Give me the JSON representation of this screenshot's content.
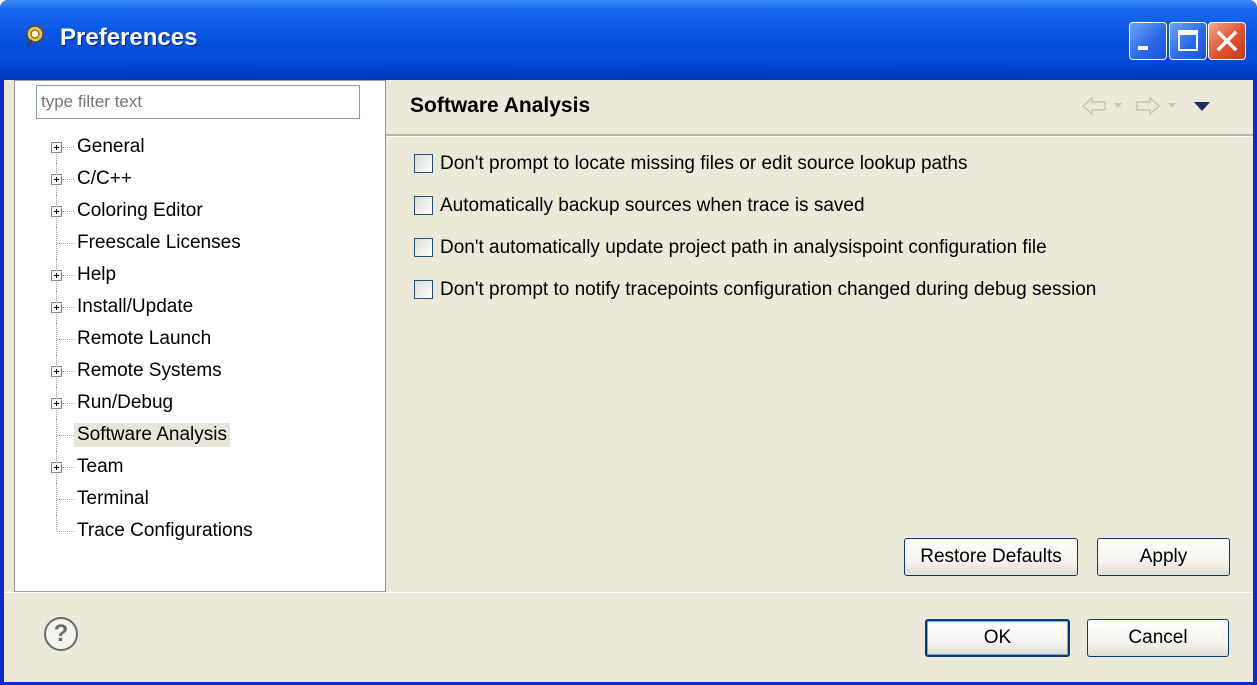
{
  "window": {
    "title": "Preferences"
  },
  "filter": {
    "placeholder": "type filter text",
    "value": ""
  },
  "tree": {
    "items": [
      {
        "label": "General",
        "expandable": true
      },
      {
        "label": "C/C++",
        "expandable": true
      },
      {
        "label": "Coloring Editor",
        "expandable": true
      },
      {
        "label": "Freescale Licenses",
        "expandable": false
      },
      {
        "label": "Help",
        "expandable": true
      },
      {
        "label": "Install/Update",
        "expandable": true
      },
      {
        "label": "Remote Launch",
        "expandable": false
      },
      {
        "label": "Remote Systems",
        "expandable": true
      },
      {
        "label": "Run/Debug",
        "expandable": true
      },
      {
        "label": "Software Analysis",
        "expandable": false,
        "selected": true
      },
      {
        "label": "Team",
        "expandable": true
      },
      {
        "label": "Terminal",
        "expandable": false
      },
      {
        "label": "Trace Configurations",
        "expandable": false
      }
    ]
  },
  "page": {
    "title": "Software Analysis",
    "nav_icons": [
      "back-arrow-icon",
      "dropdown-icon",
      "forward-arrow-icon",
      "dropdown-icon",
      "view-menu-icon"
    ],
    "options": [
      {
        "label": "Don't prompt to locate missing files or edit source lookup paths",
        "checked": false
      },
      {
        "label": "Automatically backup sources when trace is saved",
        "checked": false
      },
      {
        "label": "Don't automatically update project path in analysispoint configuration file",
        "checked": false
      },
      {
        "label": "Don't prompt to notify tracepoints configuration changed during debug session",
        "checked": false
      }
    ],
    "restore_defaults_label": "Restore Defaults",
    "apply_label": "Apply"
  },
  "footer": {
    "help_icon": "help-icon",
    "help_glyph": "?",
    "ok_label": "OK",
    "cancel_label": "Cancel"
  },
  "colors": {
    "titlebar": "#0854e3",
    "client_bg": "#ece9d8",
    "selection_bg": "#e8e5d9"
  }
}
